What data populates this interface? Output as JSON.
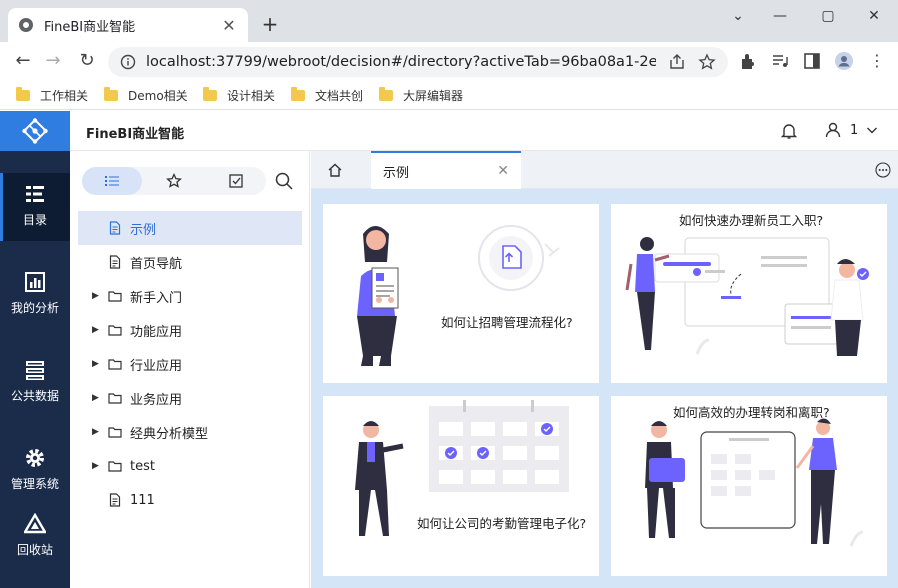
{
  "browser": {
    "tab_title": "FineBI商业智能",
    "tab_close": "✕",
    "new_tab": "+",
    "url": "localhost:37799/webroot/decision#/directory?activeTab=96ba08a1-2ed8-4...",
    "bookmarks": [
      "工作相关",
      "Demo相关",
      "设计相关",
      "文档共创",
      "大屏编辑器"
    ]
  },
  "app": {
    "title": "FineBI商业智能",
    "user": "1",
    "rail": [
      "目录",
      "我的分析",
      "公共数据",
      "管理系统",
      "回收站"
    ],
    "active_rail": "目录"
  },
  "panel": {
    "tree": [
      {
        "label": "示例",
        "type": "file",
        "selected": true
      },
      {
        "label": "首页导航",
        "type": "file"
      },
      {
        "label": "新手入门",
        "type": "folder"
      },
      {
        "label": "功能应用",
        "type": "folder"
      },
      {
        "label": "行业应用",
        "type": "folder"
      },
      {
        "label": "业务应用",
        "type": "folder"
      },
      {
        "label": "经典分析模型",
        "type": "folder"
      },
      {
        "label": "test",
        "type": "folder"
      },
      {
        "label": "111",
        "type": "file"
      }
    ]
  },
  "content": {
    "tab_label": "示例",
    "cards": [
      "如何让招聘管理流程化?",
      "如何快速办理新员工入职?",
      "如何让公司的考勤管理电子化?",
      "如何高效的办理转岗和离职?"
    ]
  },
  "colors": {
    "accent": "#2f7de1",
    "rail": "#1a2c4a",
    "illustration": "#6c63ff",
    "content_bg": "#d4e5f7"
  }
}
